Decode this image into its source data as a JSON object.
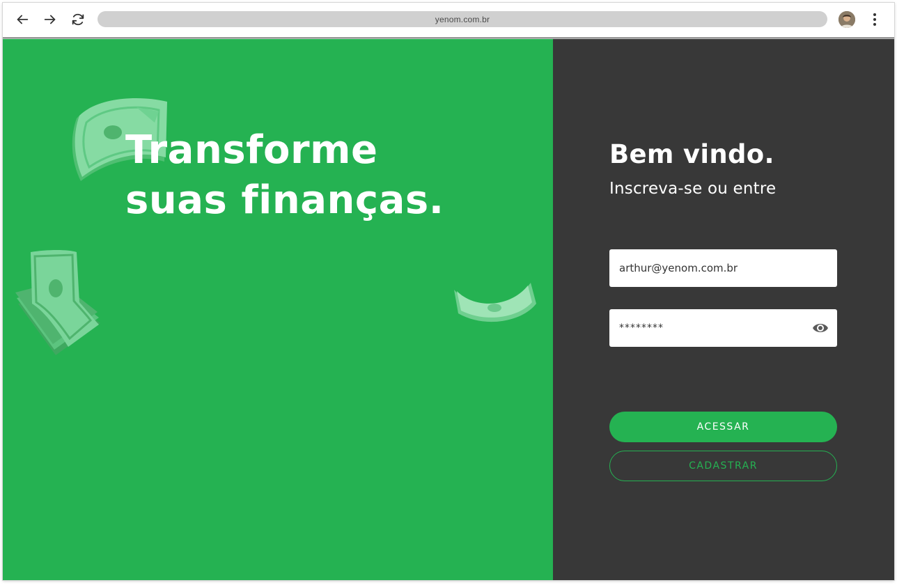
{
  "browser": {
    "url": "yenom.com.br"
  },
  "hero": {
    "line1": "Transforme",
    "line2": "suas finanças."
  },
  "login": {
    "title": "Bem vindo.",
    "subtitle": "Inscreva-se ou entre",
    "email_value": "arthur@yenom.com.br",
    "password_value": "********",
    "access_label": "ACESSAR",
    "register_label": "CADASTRAR"
  },
  "colors": {
    "brand_green": "#25b252",
    "dark_panel": "#383838",
    "bill_green": "#7fd39a"
  },
  "icons": [
    "back-arrow-icon",
    "forward-arrow-icon",
    "reload-icon",
    "more-vertical-icon",
    "eye-icon",
    "money-bill-icon"
  ]
}
